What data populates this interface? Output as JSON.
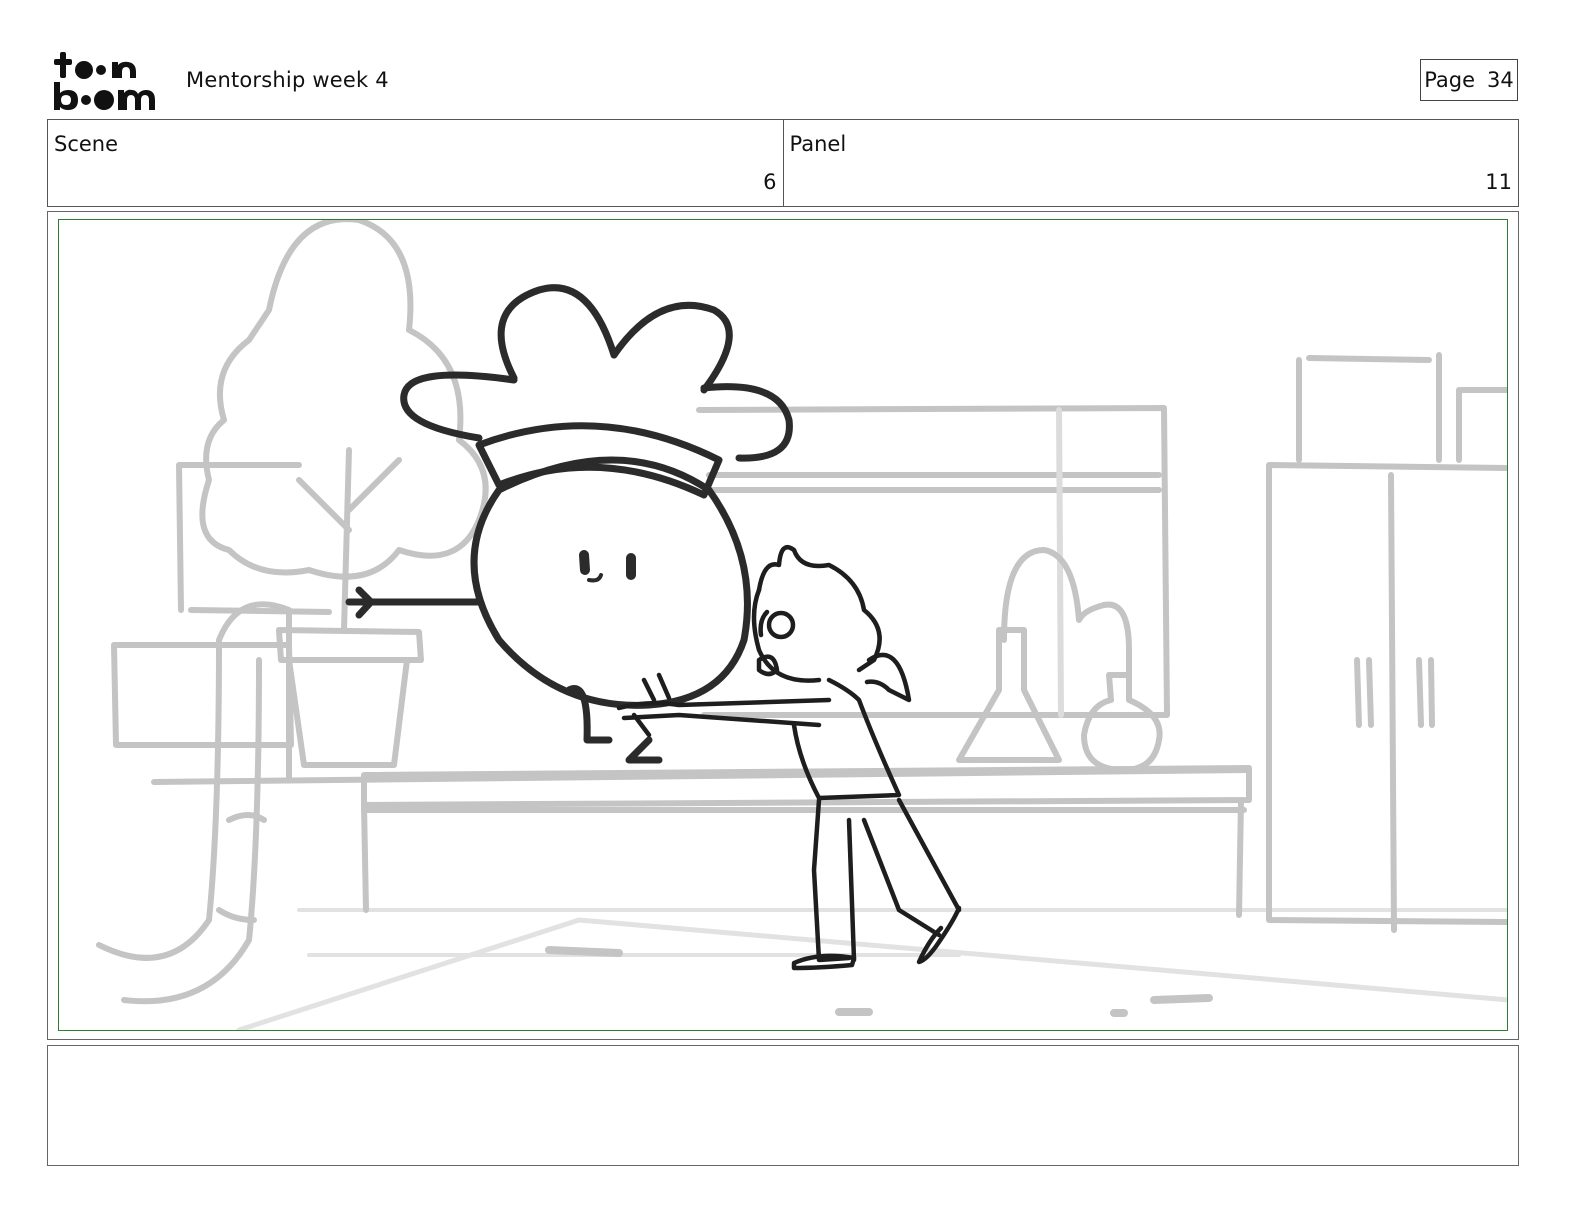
{
  "header": {
    "logo_top": "t••n",
    "logo_bottom": "b••m",
    "title": "Mentorship week 4",
    "page_label": "Page",
    "page_number": "34"
  },
  "info": {
    "scene_label": "Scene",
    "scene_value": "6",
    "panel_label": "Panel",
    "panel_value": "11"
  },
  "colors": {
    "frame_border": "#2e7d32",
    "sketch_background": "#c4c4c4",
    "sketch_foreground": "#222222"
  },
  "notes": {
    "text": ""
  }
}
